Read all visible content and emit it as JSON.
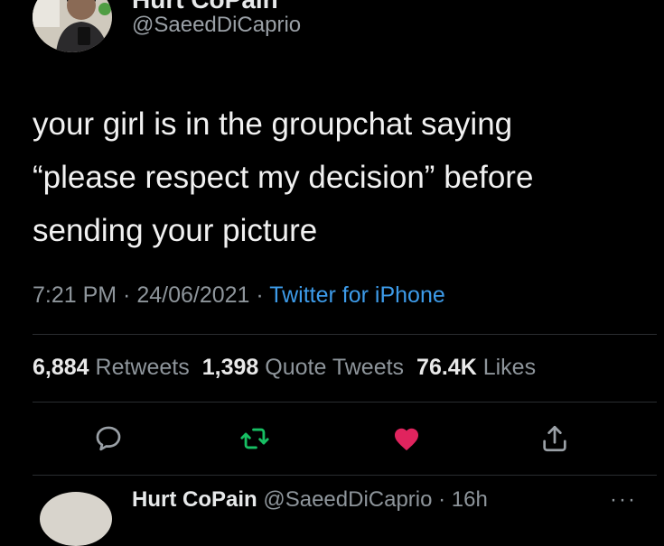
{
  "tweet": {
    "display_name": "Hurt CoPain",
    "handle": "@SaeedDiCaprio",
    "text_lines": [
      "your girl is in the groupchat saying",
      "“please respect my decision” before",
      "sending your picture"
    ],
    "time": "7:21 PM",
    "separator": " · ",
    "date": "24/06/2021",
    "source": "Twitter for iPhone"
  },
  "stats": {
    "retweets_count": "6,884",
    "retweets_label": "Retweets",
    "quote_count": "1,398",
    "quote_label": "Quote Tweets",
    "likes_count": "76.4K",
    "likes_label": "Likes"
  },
  "actions": {
    "reply_icon": "reply-icon",
    "retweet_icon": "retweet-icon",
    "like_icon": "heart-icon",
    "share_icon": "share-icon"
  },
  "next_tweet": {
    "display_name": "Hurt CoPain",
    "handle": "@SaeedDiCaprio",
    "separator": " · ",
    "time_ago": "16h",
    "more": "···"
  },
  "colors": {
    "background": "#000000",
    "link_blue": "#3d9be9",
    "retweet_green": "#17bf63",
    "like_red": "#e0245e",
    "muted_gray": "#8e959b"
  }
}
